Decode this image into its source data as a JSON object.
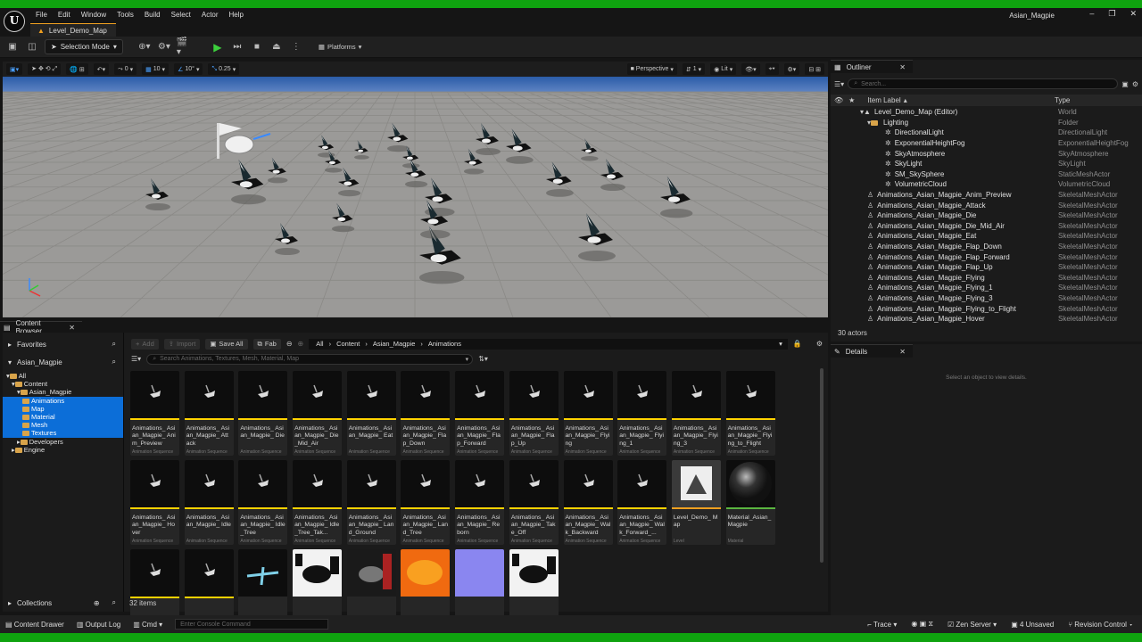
{
  "window": {
    "logo": "U",
    "title": "Asian_Magpie",
    "controls": [
      "–",
      "❐",
      "✕"
    ],
    "tab": "Level_Demo_Map"
  },
  "menu": [
    "File",
    "Edit",
    "Window",
    "Tools",
    "Build",
    "Select",
    "Actor",
    "Help"
  ],
  "toolbar": {
    "selection_mode": "Selection Mode",
    "platforms": "Platforms"
  },
  "viewport_bar": {
    "grid_snap": "10",
    "rot_snap": "10°",
    "scale_snap": "0.25",
    "zero": "0",
    "perspective": "Perspective",
    "lit": "Lit",
    "one": "1"
  },
  "outliner": {
    "tab": "Outliner",
    "search_placeholder": "Search...",
    "col_label": "Item Label",
    "col_type": "Type",
    "rows": [
      {
        "label": "Level_Demo_Map (Editor)",
        "type": "World",
        "indent": 0
      },
      {
        "label": "Lighting",
        "type": "Folder",
        "indent": 1
      },
      {
        "label": "DirectionalLight",
        "type": "DirectionalLight",
        "indent": 2
      },
      {
        "label": "ExponentialHeightFog",
        "type": "ExponentialHeightFog",
        "indent": 2
      },
      {
        "label": "SkyAtmosphere",
        "type": "SkyAtmosphere",
        "indent": 2
      },
      {
        "label": "SkyLight",
        "type": "SkyLight",
        "indent": 2
      },
      {
        "label": "SM_SkySphere",
        "type": "StaticMeshActor",
        "indent": 2
      },
      {
        "label": "VolumetricCloud",
        "type": "VolumetricCloud",
        "indent": 2
      },
      {
        "label": "Animations_Asian_Magpie_Anim_Preview",
        "type": "SkeletalMeshActor",
        "indent": 1
      },
      {
        "label": "Animations_Asian_Magpie_Attack",
        "type": "SkeletalMeshActor",
        "indent": 1
      },
      {
        "label": "Animations_Asian_Magpie_Die",
        "type": "SkeletalMeshActor",
        "indent": 1
      },
      {
        "label": "Animations_Asian_Magpie_Die_Mid_Air",
        "type": "SkeletalMeshActor",
        "indent": 1
      },
      {
        "label": "Animations_Asian_Magpie_Eat",
        "type": "SkeletalMeshActor",
        "indent": 1
      },
      {
        "label": "Animations_Asian_Magpie_Flap_Down",
        "type": "SkeletalMeshActor",
        "indent": 1
      },
      {
        "label": "Animations_Asian_Magpie_Flap_Forward",
        "type": "SkeletalMeshActor",
        "indent": 1
      },
      {
        "label": "Animations_Asian_Magpie_Flap_Up",
        "type": "SkeletalMeshActor",
        "indent": 1
      },
      {
        "label": "Animations_Asian_Magpie_Flying",
        "type": "SkeletalMeshActor",
        "indent": 1
      },
      {
        "label": "Animations_Asian_Magpie_Flying_1",
        "type": "SkeletalMeshActor",
        "indent": 1
      },
      {
        "label": "Animations_Asian_Magpie_Flying_3",
        "type": "SkeletalMeshActor",
        "indent": 1
      },
      {
        "label": "Animations_Asian_Magpie_Flying_to_Flight",
        "type": "SkeletalMeshActor",
        "indent": 1
      },
      {
        "label": "Animations_Asian_Magpie_Hover",
        "type": "SkeletalMeshActor",
        "indent": 1
      }
    ],
    "count": "30 actors"
  },
  "details": {
    "tab": "Details",
    "empty": "Select an object to view details."
  },
  "content_browser": {
    "tab": "Content Browser",
    "favorites": "Favorites",
    "project": "Asian_Magpie",
    "collections": "Collections",
    "tree": [
      {
        "label": "All",
        "indent": 0,
        "selected": false
      },
      {
        "label": "Content",
        "indent": 1,
        "selected": false
      },
      {
        "label": "Asian_Magpie",
        "indent": 2,
        "selected": false
      },
      {
        "label": "Animations",
        "indent": 3,
        "selected": true
      },
      {
        "label": "Map",
        "indent": 3,
        "selected": true
      },
      {
        "label": "Material",
        "indent": 3,
        "selected": true
      },
      {
        "label": "Mesh",
        "indent": 3,
        "selected": true
      },
      {
        "label": "Textures",
        "indent": 3,
        "selected": true
      },
      {
        "label": "Developers",
        "indent": 2,
        "selected": false
      },
      {
        "label": "Engine",
        "indent": 1,
        "selected": false
      }
    ],
    "add": "Add",
    "import": "Import",
    "save_all": "Save All",
    "fab": "Fab",
    "crumbs": [
      "All",
      "Content",
      "Asian_Magpie",
      "Animations"
    ],
    "search_placeholder": "Search Animations, Textures, Mesh, Material, Map",
    "items": [
      {
        "name": "Animations_ Asian_Magpie_ Anim_Preview",
        "type": "Animation Sequence",
        "kind": "anim"
      },
      {
        "name": "Animations_ Asian_Magpie_ Attack",
        "type": "Animation Sequence",
        "kind": "anim"
      },
      {
        "name": "Animations_ Asian_Magpie_ Die",
        "type": "Animation Sequence",
        "kind": "anim"
      },
      {
        "name": "Animations_ Asian_Magpie_ Die_Mid_Air",
        "type": "Animation Sequence",
        "kind": "anim"
      },
      {
        "name": "Animations_ Asian_Magpie_ Eat",
        "type": "Animation Sequence",
        "kind": "anim"
      },
      {
        "name": "Animations_ Asian_Magpie_ Flap_Down",
        "type": "Animation Sequence",
        "kind": "anim"
      },
      {
        "name": "Animations_ Asian_Magpie_ Flap_Forward",
        "type": "Animation Sequence",
        "kind": "anim"
      },
      {
        "name": "Animations_ Asian_Magpie_ Flap_Up",
        "type": "Animation Sequence",
        "kind": "anim"
      },
      {
        "name": "Animations_ Asian_Magpie_ Flying",
        "type": "Animation Sequence",
        "kind": "anim"
      },
      {
        "name": "Animations_ Asian_Magpie_ Flying_1",
        "type": "Animation Sequence",
        "kind": "anim"
      },
      {
        "name": "Animations_ Asian_Magpie_ Flying_3",
        "type": "Animation Sequence",
        "kind": "anim"
      },
      {
        "name": "Animations_ Asian_Magpie_ Flying_to_Flight",
        "type": "Animation Sequence",
        "kind": "anim"
      },
      {
        "name": "Animations_ Asian_Magpie_ Hover",
        "type": "Animation Sequence",
        "kind": "anim"
      },
      {
        "name": "Animations_ Asian_Magpie_ Idle",
        "type": "Animation Sequence",
        "kind": "anim"
      },
      {
        "name": "Animations_ Asian_Magpie_ Idle_Tree",
        "type": "Animation Sequence",
        "kind": "anim"
      },
      {
        "name": "Animations_ Asian_Magpie_ Idle_Tree_Tak...",
        "type": "Animation Sequence",
        "kind": "anim"
      },
      {
        "name": "Animations_ Asian_Magpie_ Land_Ground",
        "type": "Animation Sequence",
        "kind": "anim"
      },
      {
        "name": "Animations_ Asian_Magpie_ Land_Tree",
        "type": "Animation Sequence",
        "kind": "anim"
      },
      {
        "name": "Animations_ Asian_Magpie_ Reborn",
        "type": "Animation Sequence",
        "kind": "anim"
      },
      {
        "name": "Animations_ Asian_Magpie_ Take_Off",
        "type": "Animation Sequence",
        "kind": "anim"
      },
      {
        "name": "Animations_ Asian_Magpie_ Walk_Backward",
        "type": "Animation Sequence",
        "kind": "anim"
      },
      {
        "name": "Animations_ Asian_Magpie_ Walk_Forward_...",
        "type": "Animation Sequence",
        "kind": "anim"
      },
      {
        "name": "Level_Demo_ Map",
        "type": "Level",
        "kind": "level"
      },
      {
        "name": "Material_Asian_ Magpie",
        "type": "Material",
        "kind": "material"
      },
      {
        "name": "",
        "type": "",
        "kind": "anim"
      },
      {
        "name": "",
        "type": "",
        "kind": "anim"
      },
      {
        "name": "",
        "type": "",
        "kind": "mesh"
      },
      {
        "name": "",
        "type": "",
        "kind": "tex-bw"
      },
      {
        "name": "",
        "type": "",
        "kind": "tex-dark"
      },
      {
        "name": "",
        "type": "",
        "kind": "tex-orange"
      },
      {
        "name": "",
        "type": "",
        "kind": "tex-normal"
      },
      {
        "name": "",
        "type": "",
        "kind": "tex-bw2"
      }
    ],
    "count": "32 items"
  },
  "statusbar": {
    "content_drawer": "Content Drawer",
    "output_log": "Output Log",
    "cmd": "Cmd",
    "console_placeholder": "Enter Console Command",
    "trace": "Trace",
    "zen": "Zen Server",
    "unsaved": "4 Unsaved",
    "revision": "Revision Control"
  },
  "colors": {
    "accent_blue": "#0c6ed8",
    "play_green": "#3ccf3c",
    "anim_bar": "#ffd200",
    "level_bar": "#f0a020",
    "mat_bar": "#5ab53f",
    "frame_green": "#0fa30f"
  }
}
